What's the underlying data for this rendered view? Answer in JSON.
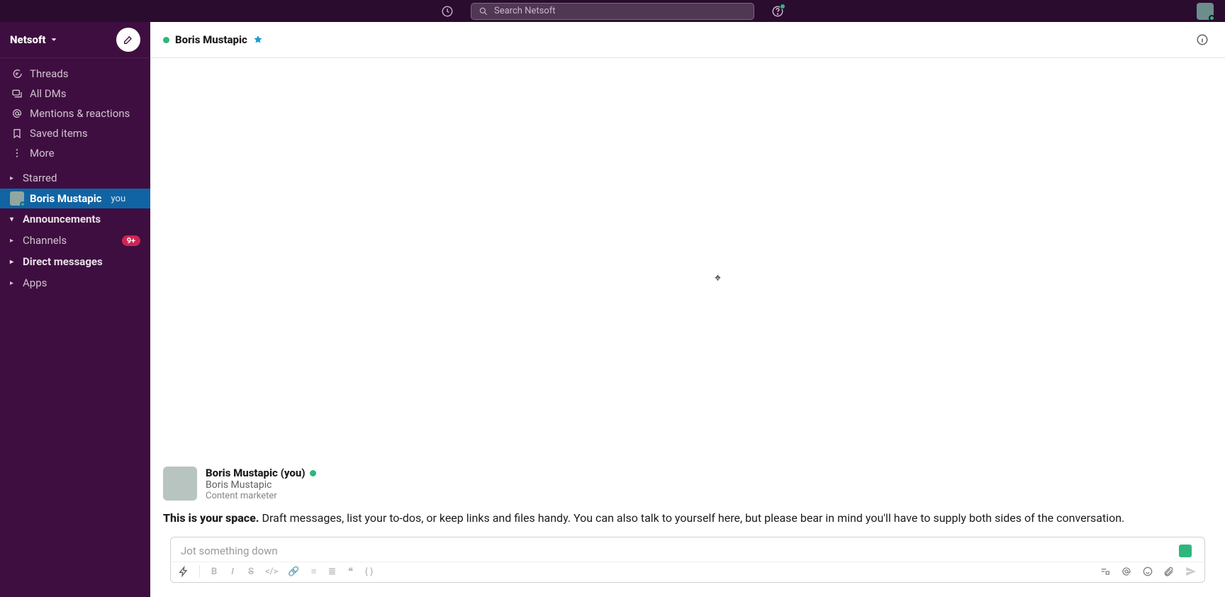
{
  "topbar": {
    "search_placeholder": "Search Netsoft"
  },
  "workspace": {
    "name": "Netsoft"
  },
  "sidebar": {
    "nav": [
      {
        "label": "Threads",
        "icon": "threads"
      },
      {
        "label": "All DMs",
        "icon": "dms"
      },
      {
        "label": "Mentions & reactions",
        "icon": "mentions"
      },
      {
        "label": "Saved items",
        "icon": "saved"
      },
      {
        "label": "More",
        "icon": "more"
      }
    ],
    "sections": {
      "starred": {
        "label": "Starred",
        "expanded": false
      },
      "self_dm": {
        "name": "Boris Mustapic",
        "tag": "you"
      },
      "announcements": {
        "label": "Announcements",
        "expanded": true
      },
      "channels": {
        "label": "Channels",
        "expanded": false,
        "badge": "9+"
      },
      "dms": {
        "label": "Direct messages",
        "expanded": false
      },
      "apps": {
        "label": "Apps",
        "expanded": false
      }
    }
  },
  "header": {
    "title": "Boris Mustapic"
  },
  "intro": {
    "display_name": "Boris Mustapic (you)",
    "real_name": "Boris Mustapic",
    "role": "Content marketer",
    "lead": "This is your space.",
    "rest": "Draft messages, list your to-dos, or keep links and files handy. You can also talk to yourself here, but please bear in mind you'll have to supply both sides of the conversation."
  },
  "composer": {
    "placeholder": "Jot something down"
  }
}
